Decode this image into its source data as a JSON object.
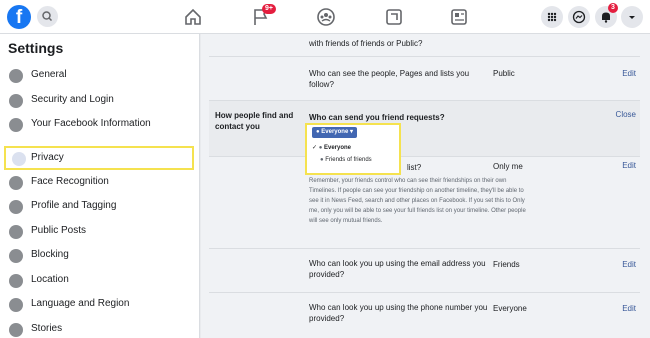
{
  "topbar": {
    "logo": "f",
    "notif_count_flag": "9+",
    "notif_count_bell": "3",
    "icons": [
      "search-icon",
      "home-icon",
      "flag-icon",
      "groups-icon",
      "gaming-icon",
      "news-icon",
      "grid-icon",
      "messenger-icon",
      "bell-icon",
      "caret-down-icon"
    ]
  },
  "sidebar": {
    "title": "Settings",
    "items": [
      {
        "label": "General",
        "icon": "gear-icon"
      },
      {
        "label": "Security and Login",
        "icon": "shield-icon"
      },
      {
        "label": "Your Facebook Information",
        "icon": "grid-icon"
      },
      {
        "label": "Privacy",
        "icon": "lock-icon",
        "active": true
      },
      {
        "label": "Face Recognition",
        "icon": "face-icon"
      },
      {
        "label": "Profile and Tagging",
        "icon": "tag-icon"
      },
      {
        "label": "Public Posts",
        "icon": "globe-icon"
      },
      {
        "label": "Blocking",
        "icon": "block-icon"
      },
      {
        "label": "Location",
        "icon": "location-icon"
      },
      {
        "label": "Language and Region",
        "icon": "language-icon"
      },
      {
        "label": "Stories",
        "icon": "stories-icon"
      }
    ]
  },
  "main": {
    "top_partial": "with friends of friends or Public?",
    "rows": [
      {
        "question": "Who can see the people, Pages and lists you follow?",
        "value": "Public",
        "action": "Edit"
      },
      {
        "question": "Who can send you friend requests?",
        "value": "",
        "action": "Close"
      },
      {
        "question": "list?",
        "value": "Only me",
        "action": "Edit"
      },
      {
        "question": "Who can look you up using the email address you provided?",
        "value": "Friends",
        "action": "Edit"
      },
      {
        "question": "Who can look you up using the phone number you provided?",
        "value": "Everyone",
        "action": "Edit"
      }
    ],
    "section_label": "How people find and contact you",
    "description": "Remember, your friends control who can see their friendships on their own Timelines. If people can see your friendship on another timeline, they'll be able to see it in News Feed, search and other places on Facebook. If you set this to Only me, only you will be able to see your full friends list on your timeline. Other people will see only mutual friends.",
    "dropdown": {
      "selected": "Everyone",
      "options": [
        {
          "label": "Everyone",
          "checked": true
        },
        {
          "label": "Friends of friends",
          "checked": false
        }
      ]
    }
  }
}
